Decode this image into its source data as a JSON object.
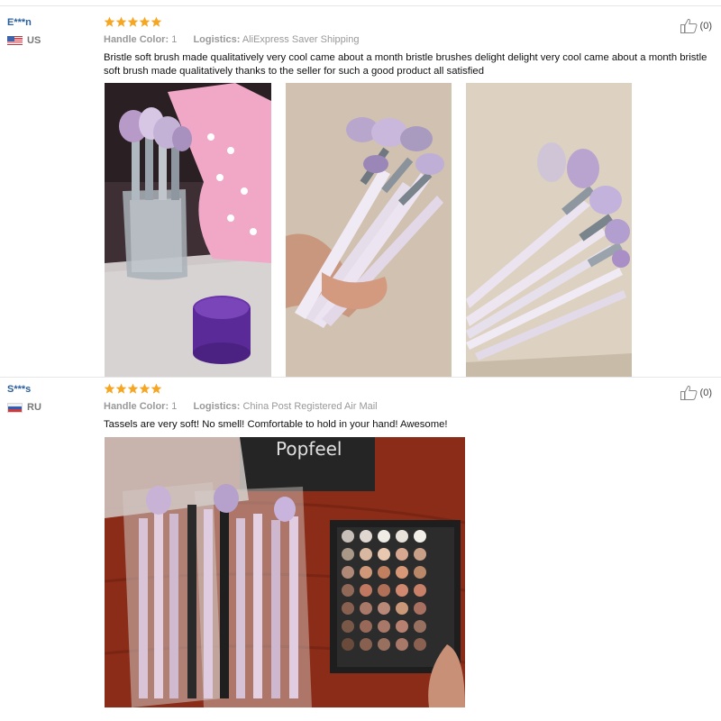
{
  "reviews": [
    {
      "user": "E***n",
      "country": "US",
      "rating": 5,
      "handle_color_label": "Handle Color:",
      "handle_color_value": "1",
      "logistics_label": "Logistics:",
      "logistics_value": "AliExpress Saver Shipping",
      "text": "Bristle soft brush made qualitatively very cool came about a month bristle brushes delight delight very cool came about a month bristle soft brush made qualitatively thanks to the seller for such a good product all satisfied",
      "helpful_count": "(0)",
      "photos": [
        {
          "name": "brushes-in-glass-jar"
        },
        {
          "name": "brushes-in-hand"
        },
        {
          "name": "brushes-fanned-out"
        }
      ]
    },
    {
      "user": "S***s",
      "country": "RU",
      "rating": 5,
      "handle_color_label": "Handle Color:",
      "handle_color_value": "1",
      "logistics_label": "Logistics:",
      "logistics_value": "China Post Registered Air Mail",
      "text": "Tassels are very soft! No smell! Comfortable to hold in your hand! Awesome!",
      "helpful_count": "(0)",
      "photos": [
        {
          "name": "brushes-and-eyeshadow-palette",
          "box_text": "Popfeel"
        }
      ]
    }
  ],
  "colors": {
    "star": "#f5a623",
    "username": "#2b5e9d",
    "meta": "#999999",
    "text": "#111111"
  }
}
